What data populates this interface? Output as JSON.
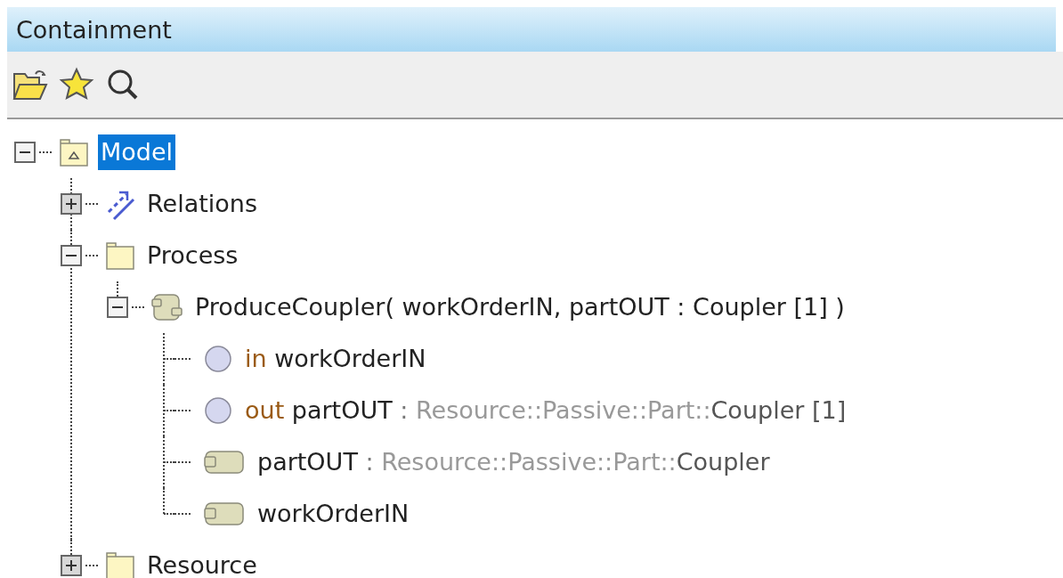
{
  "panel": {
    "title": "Containment"
  },
  "tree": [
    {
      "kind": "model",
      "name": "Model",
      "selected": true,
      "expanded": true,
      "children": [
        {
          "kind": "relations",
          "name": "Relations",
          "selected": false,
          "expanded": false
        },
        {
          "kind": "package",
          "name": "Process",
          "selected": false,
          "expanded": true,
          "children": [
            {
              "kind": "activity",
              "name": "ProduceCoupler( workOrderIN, partOUT : Coupler [1] )",
              "selected": false,
              "expanded": true,
              "children": [
                {
                  "kind": "parameter",
                  "keyword": "in",
                  "name": "workOrderIN",
                  "selected": false
                },
                {
                  "kind": "parameter",
                  "keyword": "out",
                  "name": "partOUT",
                  "colon": ":",
                  "type_qualifier": "Resource::Passive::Part::",
                  "type_name": "Coupler [1]",
                  "selected": false
                },
                {
                  "kind": "pin",
                  "name": "partOUT",
                  "colon": ":",
                  "type_qualifier": "Resource::Passive::Part::",
                  "type_name": "Coupler",
                  "selected": false
                },
                {
                  "kind": "pin",
                  "name": "workOrderIN",
                  "selected": false
                }
              ]
            }
          ]
        },
        {
          "kind": "package",
          "name": "Resource",
          "selected": false,
          "expanded": false
        }
      ]
    }
  ]
}
